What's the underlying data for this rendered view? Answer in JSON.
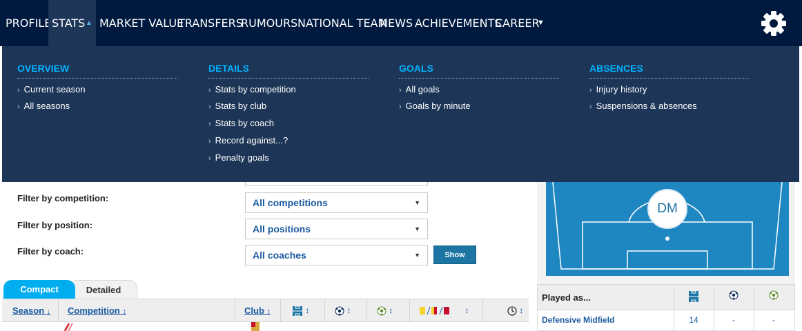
{
  "nav": {
    "items": [
      {
        "label": "PROFILE"
      },
      {
        "label": "STATS"
      },
      {
        "label": "MARKET VALUE"
      },
      {
        "label": "TRANSFERS"
      },
      {
        "label": "RUMOURS"
      },
      {
        "label": "NATIONAL TEAM"
      },
      {
        "label": "NEWS"
      },
      {
        "label": "ACHIEVEMENTS"
      },
      {
        "label": "CAREER"
      }
    ],
    "active": "STATS",
    "icons": {
      "settings": "gear-icon",
      "expand": "caret-up-icon",
      "more": "caret-down-icon"
    }
  },
  "menu": {
    "columns": [
      {
        "title": "OVERVIEW",
        "items": [
          "Current season",
          "All seasons"
        ]
      },
      {
        "title": "DETAILS",
        "items": [
          "Stats by competition",
          "Stats by club",
          "Stats by coach",
          "Record against...?",
          "Penalty goals"
        ]
      },
      {
        "title": "GOALS",
        "items": [
          "All goals",
          "Goals by minute"
        ]
      },
      {
        "title": "ABSENCES",
        "items": [
          "Injury history",
          "Suspensions & absences"
        ]
      }
    ]
  },
  "filters": {
    "competition_label": "Filter by competition:",
    "competition_value": "All competitions",
    "position_label": "Filter by position:",
    "position_value": "All positions",
    "coach_label": "Filter by coach:",
    "coach_value": "All coaches",
    "show_label": "Show"
  },
  "tabs": {
    "compact": "Compact",
    "detailed": "Detailed"
  },
  "table": {
    "headers": {
      "season": "Season",
      "competition": "Competition",
      "club": "Club"
    },
    "icons": [
      "appearances-icon",
      "goals-icon",
      "assists-icon",
      "cards-icon",
      "minutes-icon"
    ]
  },
  "position": {
    "badge": "DM",
    "played_as_label": "Played as...",
    "row": {
      "position": "Defensive Midfield",
      "appearances": "14",
      "goals": "-",
      "assists": "-"
    }
  },
  "colors": {
    "nav_bg": "#00193f",
    "menu_bg": "#1d3557",
    "menu_heading": "#00b4ff",
    "link": "#1a5aa0",
    "tab_active": "#00aeef",
    "pitch": "#1e87c2",
    "button": "#1d75a3"
  }
}
